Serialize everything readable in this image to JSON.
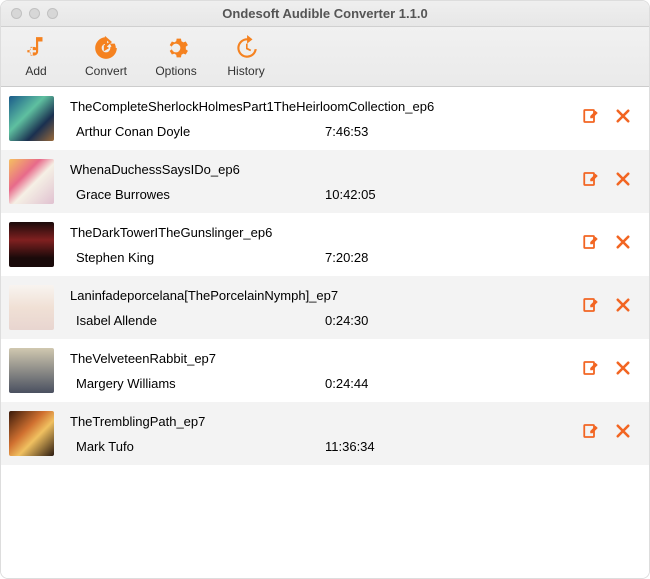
{
  "window": {
    "title": "Ondesoft Audible Converter 1.1.0"
  },
  "toolbar": {
    "add": "Add",
    "convert": "Convert",
    "options": "Options",
    "history": "History"
  },
  "items": [
    {
      "title": "TheCompleteSherlockHolmesPart1TheHeirloomCollection_ep6",
      "author": "Arthur Conan Doyle",
      "duration": "7:46:53"
    },
    {
      "title": "WhenaDuchessSaysIDo_ep6",
      "author": "Grace Burrowes",
      "duration": "10:42:05"
    },
    {
      "title": "TheDarkTowerITheGunslinger_ep6",
      "author": "Stephen King",
      "duration": "7:20:28"
    },
    {
      "title": "Laninfadeporcelana[ThePorcelainNymph]_ep7",
      "author": "Isabel Allende",
      "duration": "0:24:30"
    },
    {
      "title": "TheVelveteenRabbit_ep7",
      "author": "Margery Williams",
      "duration": "0:24:44"
    },
    {
      "title": "TheTremblingPath_ep7",
      "author": "Mark Tufo",
      "duration": "11:36:34"
    }
  ]
}
